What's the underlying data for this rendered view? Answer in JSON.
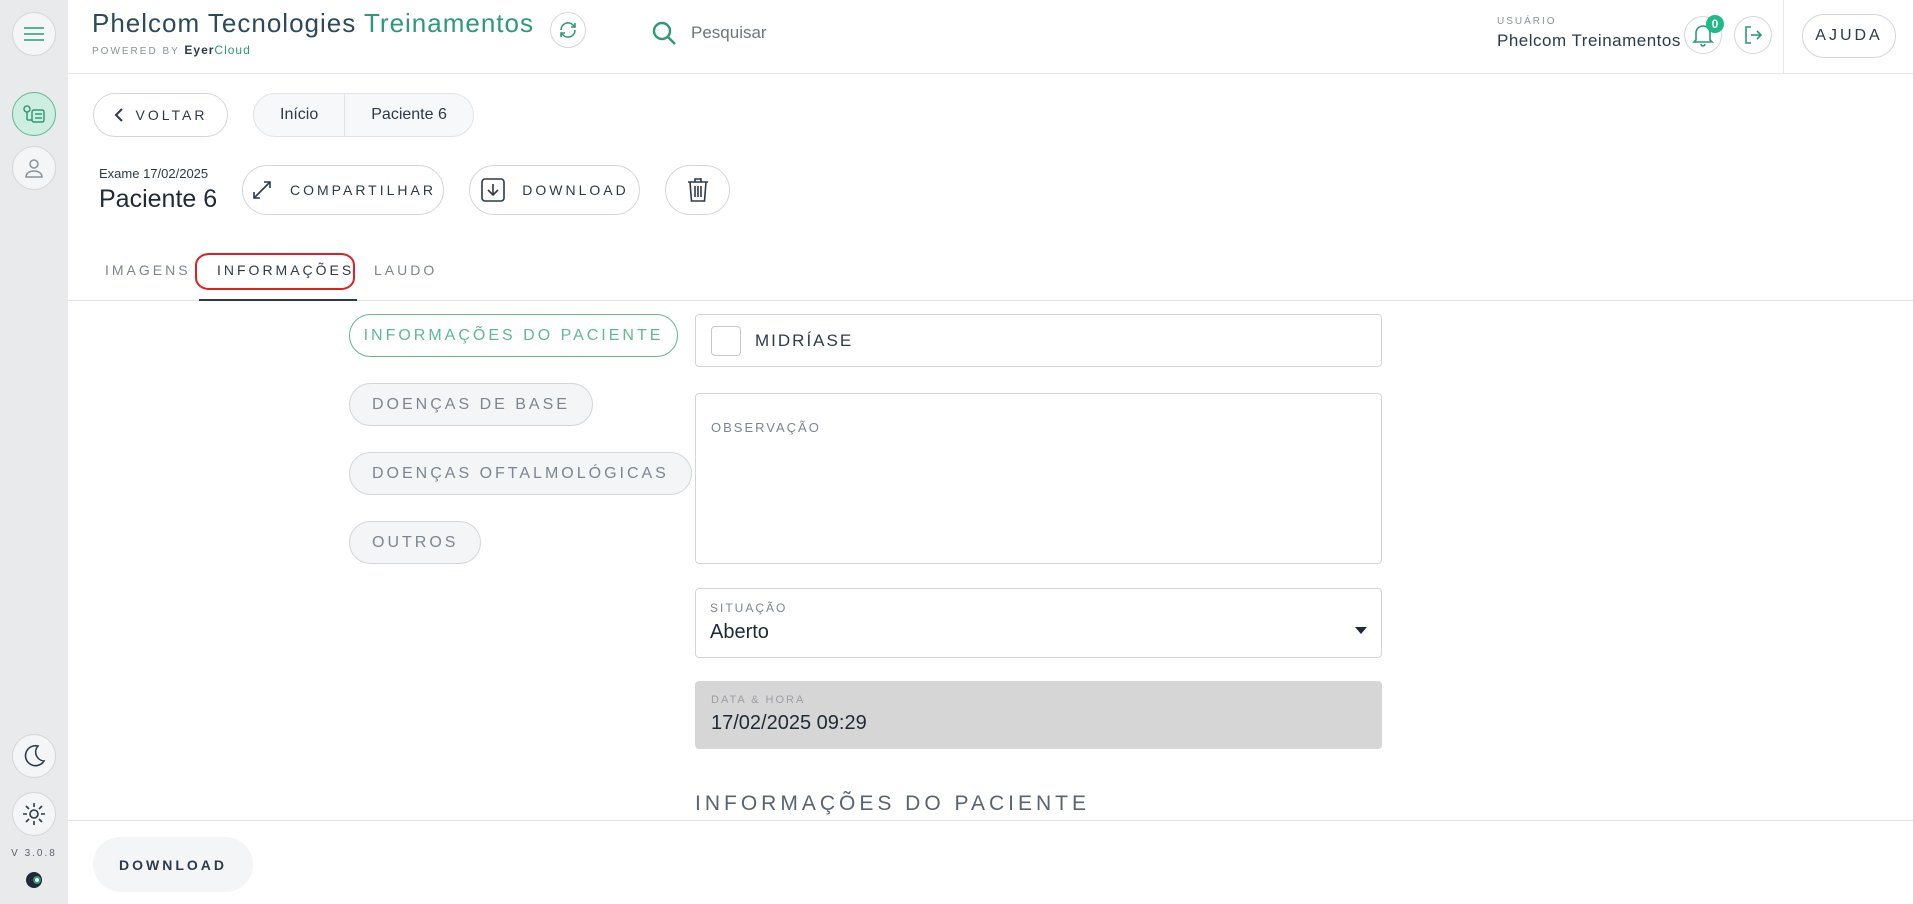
{
  "colors": {
    "accent": "#2e9a74",
    "accent_light": "#5fb990",
    "badge": "#1fb98a",
    "highlight": "#e02020"
  },
  "rail": {
    "version": "V 3.0.8"
  },
  "header": {
    "brand_prefix": "Phelcom Tecnologies",
    "brand_accent": "Treinamentos",
    "powered_by": "POWERED BY",
    "powered_brand": "Eyer",
    "powered_cloud": "Cloud",
    "search_placeholder": "Pesquisar",
    "user_label": "USUÁRIO",
    "user_name": "Phelcom Treinamentos",
    "notifications_count": "0",
    "help_label": "AJUDA"
  },
  "nav": {
    "back_label": "VOLTAR",
    "breadcrumb": [
      "Início",
      "Paciente 6"
    ]
  },
  "exam": {
    "date_label": "Exame 17/02/2025",
    "patient_name": "Paciente 6",
    "share_label": "COMPARTILHAR",
    "download_label": "DOWNLOAD"
  },
  "tabs": [
    {
      "label": "IMAGENS",
      "active": false
    },
    {
      "label": "INFORMAÇÕES",
      "active": true
    },
    {
      "label": "LAUDO",
      "active": false
    }
  ],
  "sections": [
    {
      "label": "INFORMAÇÕES DO PACIENTE",
      "active": true
    },
    {
      "label": "DOENÇAS DE BASE",
      "active": false
    },
    {
      "label": "DOENÇAS OFTALMOLÓGICAS",
      "active": false
    },
    {
      "label": "OUTROS",
      "active": false
    }
  ],
  "form": {
    "midriase_label": "MIDRÍASE",
    "midriase_checked": false,
    "observacao_label": "OBSERVAÇÃO",
    "situacao_label": "SITUAÇÃO",
    "situacao_value": "Aberto",
    "datahora_label": "DATA & HORA",
    "datahora_value": "17/02/2025 09:29",
    "section_heading": "INFORMAÇÕES DO PACIENTE"
  },
  "footer": {
    "download_label": "DOWNLOAD"
  }
}
